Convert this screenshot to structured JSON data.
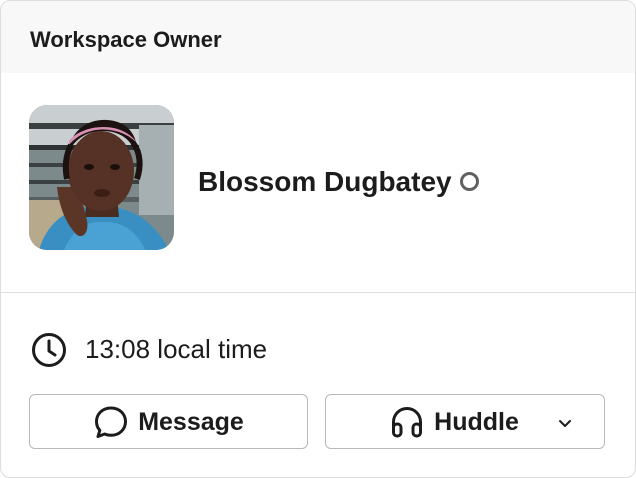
{
  "header": {
    "title": "Workspace Owner"
  },
  "profile": {
    "display_name": "Blossom Dugbatey",
    "presence": "away",
    "avatar_icon": "user-avatar-photo"
  },
  "local_time": {
    "icon": "clock-icon",
    "text": "13:08 local time"
  },
  "actions": {
    "message": {
      "label": "Message",
      "icon": "chat-bubble-icon"
    },
    "huddle": {
      "label": "Huddle",
      "icon": "headphones-icon",
      "menu_icon": "chevron-down-icon"
    }
  },
  "colors": {
    "header_bg": "#f8f8f8",
    "text": "#1d1c1d",
    "border": "#b9b9b9",
    "divider": "#dddddd",
    "presence_ring": "#616061"
  }
}
